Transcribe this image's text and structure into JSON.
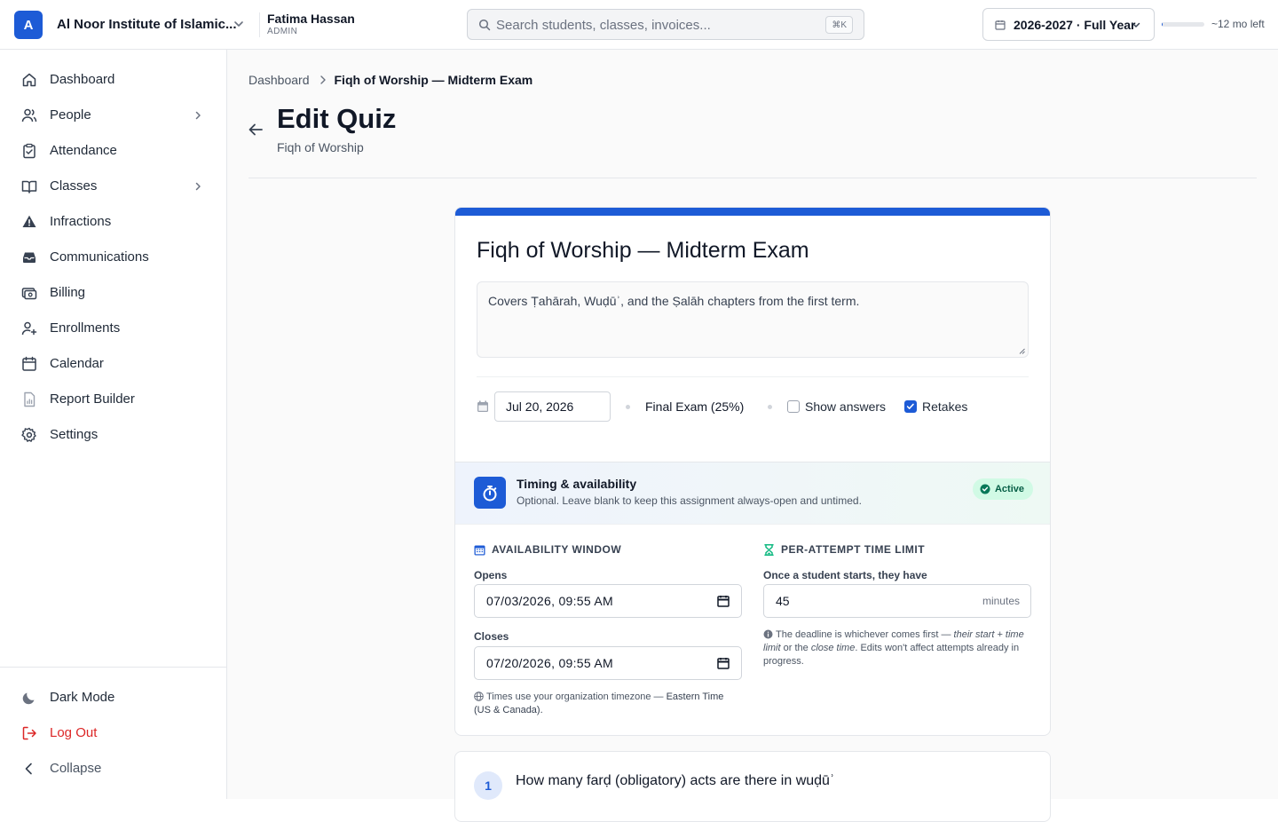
{
  "topbar": {
    "org_initial": "A",
    "org_name": "Al Noor Institute of Islamic...",
    "user_name": "Fatima Hassan",
    "user_role": "ADMIN",
    "search_placeholder": "Search students, classes, invoices...",
    "search_shortcut": "⌘K",
    "year_label": "2026-2027 · Full Year",
    "year_progress_fraction": 0.02,
    "time_left": "~12 mo left"
  },
  "sidebar": {
    "items": [
      {
        "label": "Dashboard",
        "icon": "home-icon"
      },
      {
        "label": "People",
        "icon": "users-icon",
        "expandable": true
      },
      {
        "label": "Attendance",
        "icon": "clipboard-check-icon"
      },
      {
        "label": "Classes",
        "icon": "book-open-icon",
        "expandable": true
      },
      {
        "label": "Infractions",
        "icon": "warning-icon"
      },
      {
        "label": "Communications",
        "icon": "inbox-icon"
      },
      {
        "label": "Billing",
        "icon": "billing-icon"
      },
      {
        "label": "Enrollments",
        "icon": "user-plus-icon"
      },
      {
        "label": "Calendar",
        "icon": "calendar-icon"
      },
      {
        "label": "Report Builder",
        "icon": "report-icon"
      },
      {
        "label": "Settings",
        "icon": "gear-icon"
      }
    ],
    "bottom": {
      "dark_mode": "Dark Mode",
      "logout": "Log Out",
      "collapse": "Collapse"
    }
  },
  "breadcrumb": {
    "root": "Dashboard",
    "current": "Fiqh of Worship — Midterm Exam"
  },
  "page": {
    "title": "Edit Quiz",
    "subtitle": "Fiqh of Worship"
  },
  "quiz": {
    "title": "Fiqh of Worship — Midterm Exam",
    "description": "Covers Ṭahārah, Wuḍūʾ, and the Ṣalāh chapters from the first term.",
    "due_date": "Jul 20, 2026",
    "category": "Final Exam (25%)",
    "show_answers_label": "Show answers",
    "show_answers_checked": false,
    "retakes_label": "Retakes",
    "retakes_checked": true
  },
  "timing": {
    "title": "Timing & availability",
    "subtitle": "Optional. Leave blank to keep this assignment always-open and untimed.",
    "status": "Active",
    "availability_heading": "AVAILABILITY WINDOW",
    "opens_label": "Opens",
    "opens_value": "07/03/2026, 09:55 AM",
    "closes_label": "Closes",
    "closes_value": "07/20/2026, 09:55 AM",
    "tz_prefix": "Times use your organization timezone — ",
    "tz_name": "Eastern Time (US & Canada).",
    "limit_heading": "PER-ATTEMPT TIME LIMIT",
    "limit_label": "Once a student starts, they have",
    "limit_value": "45",
    "limit_unit": "minutes",
    "note_1": "The deadline is whichever comes first — ",
    "note_em_1": "their start + time limit",
    "note_2": " or the ",
    "note_em_2": "close time",
    "note_3": ". Edits won't affect attempts already in progress."
  },
  "question": {
    "number": "1",
    "text": "How many farḍ (obligatory) acts are there in wuḍūʾ"
  },
  "colors": {
    "accent": "#1d5bd6",
    "danger": "#dc2626",
    "success_bg": "#d1fae5",
    "success_text": "#065f46"
  }
}
